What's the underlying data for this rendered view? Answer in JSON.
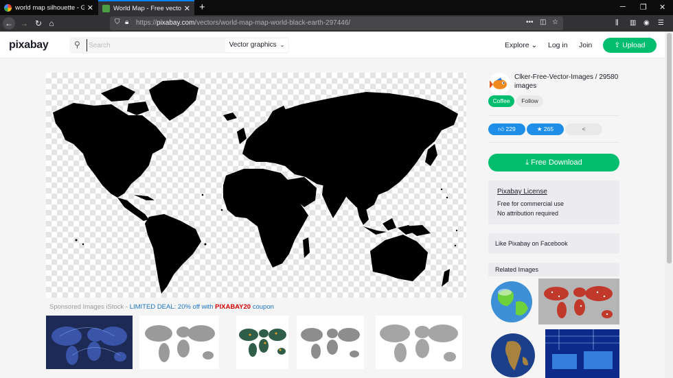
{
  "browser": {
    "tabs": [
      {
        "title": "world map silhouette - Google",
        "active": false
      },
      {
        "title": "World Map - Free vector graph",
        "active": true
      }
    ],
    "url_prefix": "https://",
    "url_host": "pixabay.com",
    "url_path": "/vectors/world-map-map-world-black-earth-297446/"
  },
  "header": {
    "logo": "pixabay",
    "search_placeholder": "Search",
    "category": "Vector graphics",
    "explore": "Explore",
    "login": "Log in",
    "join": "Join",
    "upload": "Upload"
  },
  "sponsored": {
    "prefix": "Sponsored Images iStock - ",
    "deal": "LIMITED DEAL: 20% off with ",
    "code": "PIXABAY20",
    "suffix": " coupon"
  },
  "author": {
    "line1": "Clker-Free-Vector-Images / 29580",
    "line2": "images",
    "coffee": "Coffee",
    "follow": "Follow"
  },
  "stats": {
    "likes": "229",
    "favorites": "265"
  },
  "download": {
    "label": "Free Download"
  },
  "license": {
    "link": "Pixabay License",
    "line1": "Free for commercial use",
    "line2": "No attribution required"
  },
  "facebook": "Like Pixabay on Facebook",
  "related_title": "Related Images",
  "colors": {
    "brand_green": "#02be6e",
    "stat_blue": "#1e8ee8",
    "browser_dark": "#0c0c0d",
    "accent_blue": "#0a84ff"
  }
}
